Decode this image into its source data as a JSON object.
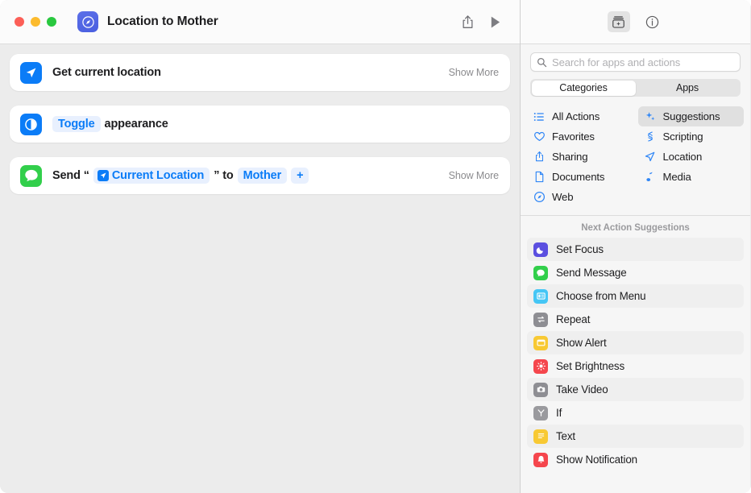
{
  "window": {
    "traffic_lights": [
      {
        "name": "close",
        "color": "#fc5f57"
      },
      {
        "name": "minimize",
        "color": "#fcbb2e"
      },
      {
        "name": "zoom",
        "color": "#29c83f"
      }
    ],
    "title": "Location to Mother",
    "app_icon": "compass-icon",
    "toolbar": [
      {
        "name": "share-button",
        "icon": "share-icon"
      },
      {
        "name": "run-button",
        "icon": "play-icon"
      }
    ]
  },
  "editor": {
    "actions": [
      {
        "icon": "location-arrow-icon",
        "icon_color": "#0b7cf7",
        "segments": [
          {
            "type": "text",
            "text": "Get current location"
          }
        ],
        "show_more": "Show More",
        "has_show_more": true
      },
      {
        "icon": "appearance-toggle-icon",
        "icon_color": "#0b7cf7",
        "segments": [
          {
            "type": "pill",
            "text": "Toggle"
          },
          {
            "type": "text",
            "text": "appearance"
          }
        ],
        "show_more": "",
        "has_show_more": false
      },
      {
        "icon": "messages-icon",
        "icon_color": "#32cf4b",
        "segments": [
          {
            "type": "text",
            "text": "Send “"
          },
          {
            "type": "pill-icon",
            "text": "Current Location",
            "pill_icon": "location-arrow-icon"
          },
          {
            "type": "text",
            "text": "” to"
          },
          {
            "type": "pill",
            "text": "Mother"
          },
          {
            "type": "pill",
            "text": "+"
          }
        ],
        "show_more": "Show More",
        "has_show_more": true
      }
    ]
  },
  "sidebar": {
    "top_buttons": [
      {
        "name": "action-library-button",
        "icon": "add-action-icon",
        "active": true
      },
      {
        "name": "shortcut-details-button",
        "icon": "info-circle-icon",
        "active": false
      }
    ],
    "search": {
      "placeholder": "Search for apps and actions",
      "value": "",
      "icon": "search-icon"
    },
    "tabs": [
      {
        "label": "Categories",
        "selected": true
      },
      {
        "label": "Apps",
        "selected": false
      }
    ],
    "categories": [
      {
        "label": "All Actions",
        "icon": "list-bullet-icon",
        "selected": false,
        "column": 0
      },
      {
        "label": "Suggestions",
        "icon": "sparkles-icon",
        "selected": true,
        "column": 1
      },
      {
        "label": "Favorites",
        "icon": "heart-icon",
        "selected": false,
        "column": 0
      },
      {
        "label": "Scripting",
        "icon": "scripting-icon",
        "selected": false,
        "column": 1
      },
      {
        "label": "Sharing",
        "icon": "share-icon",
        "selected": false,
        "column": 0
      },
      {
        "label": "Location",
        "icon": "location-arrow-icon",
        "selected": false,
        "column": 1
      },
      {
        "label": "Documents",
        "icon": "document-icon",
        "selected": false,
        "column": 0
      },
      {
        "label": "Media",
        "icon": "music-note-icon",
        "selected": false,
        "column": 1
      },
      {
        "label": "Web",
        "icon": "compass-icon",
        "selected": false,
        "column": 0
      }
    ],
    "suggestions_header": "Next Action Suggestions",
    "suggestions": [
      {
        "label": "Set Focus",
        "icon": "moon-icon",
        "icon_color": "#5b4fe0"
      },
      {
        "label": "Send Message",
        "icon": "messages-icon",
        "icon_color": "#32cf4b"
      },
      {
        "label": "Choose from Menu",
        "icon": "menu-icon",
        "icon_color": "#45c6f5"
      },
      {
        "label": "Repeat",
        "icon": "repeat-icon",
        "icon_color": "#8e8e93"
      },
      {
        "label": "Show Alert",
        "icon": "alert-window-icon",
        "icon_color": "#f8c933"
      },
      {
        "label": "Set Brightness",
        "icon": "brightness-icon",
        "icon_color": "#f5464d"
      },
      {
        "label": "Take Video",
        "icon": "camera-icon",
        "icon_color": "#8e8e93"
      },
      {
        "label": "If",
        "icon": "branch-icon",
        "icon_color": "#9a9a9e"
      },
      {
        "label": "Text",
        "icon": "text-lines-icon",
        "icon_color": "#f8c933"
      },
      {
        "label": "Show Notification",
        "icon": "bell-icon",
        "icon_color": "#f5464d"
      }
    ]
  }
}
